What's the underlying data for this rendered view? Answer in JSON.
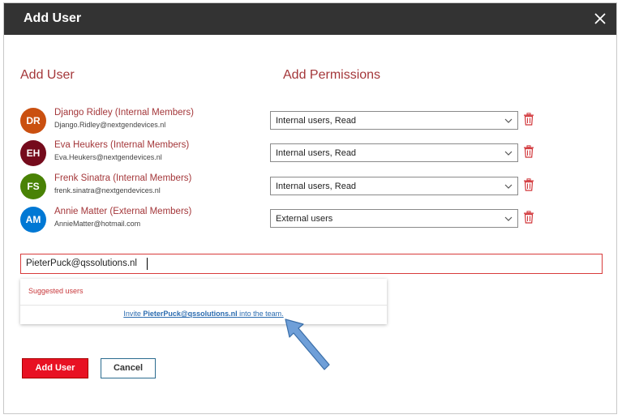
{
  "dialog": {
    "title": "Add User",
    "close_icon": "close-icon"
  },
  "headers": {
    "add_user": "Add User",
    "add_permissions": "Add Permissions"
  },
  "users": [
    {
      "initials": "DR",
      "name": "Django Ridley (Internal Members)",
      "email": "Django.Ridley@nextgendevices.nl",
      "permission": "Internal users, Read",
      "avatar_color": "#ca5010"
    },
    {
      "initials": "EH",
      "name": "Eva Heukers (Internal Members)",
      "email": "Eva.Heukers@nextgendevices.nl",
      "permission": "Internal users, Read",
      "avatar_color": "#750b1c"
    },
    {
      "initials": "FS",
      "name": "Frenk Sinatra (Internal Members)",
      "email": "frenk.sinatra@nextgendevices.nl",
      "permission": "Internal users, Read",
      "avatar_color": "#498205"
    },
    {
      "initials": "AM",
      "name": "Annie Matter (External Members)",
      "email": "AnnieMatter@hotmail.com",
      "permission": "External users",
      "avatar_color": "#0078d4"
    }
  ],
  "search": {
    "value": "PieterPuck@qssolutions.nl"
  },
  "suggestions": {
    "heading": "Suggested users",
    "invite_prefix": "Invite ",
    "invite_email": "PieterPuck@qssolutions.nl",
    "invite_suffix": " into the team."
  },
  "buttons": {
    "add_user": "Add User",
    "cancel": "Cancel"
  },
  "colors": {
    "accent": "#a4373a",
    "primary_button": "#e81123",
    "title_bar": "#333333"
  }
}
